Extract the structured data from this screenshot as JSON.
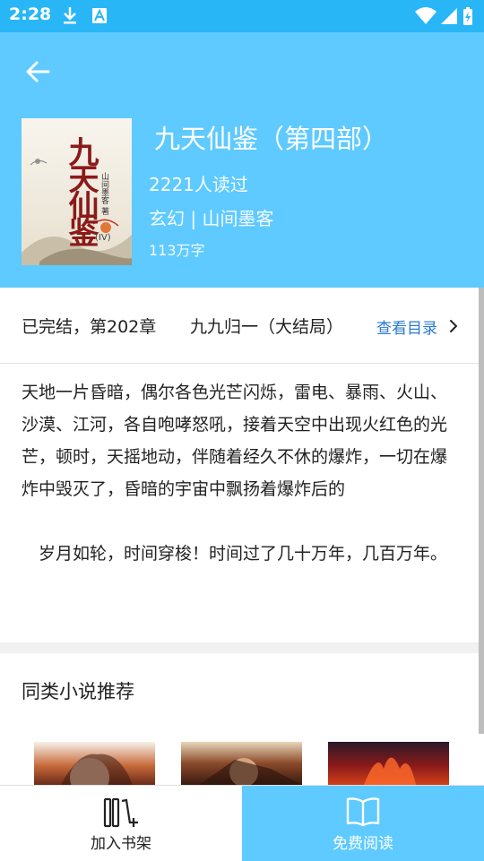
{
  "status_bar": {
    "time": "2:28"
  },
  "book": {
    "cover_title": "九天仙鉴",
    "cover_subtitle": "山间墨客 著",
    "cover_volume": "(IV)",
    "title": "九天仙鉴（第四部）",
    "readers": "2221人读过",
    "genre_author": "玄幻 | 山间墨客",
    "word_count": "113万字"
  },
  "chapter": {
    "status": "已完结，第202章",
    "latest_title": "九九归一（大结局）",
    "toc_label": "查看目录"
  },
  "synopsis": [
    "天地一片昏暗，偶尔各色光芒闪烁，雷电、暴雨、火山、沙漠、江河，各自咆哮怒吼，接着天空中出现火红色的光芒，顿时，天摇地动，伴随着经久不休的爆炸，一切在爆炸中毁灭了，昏暗的宇宙中飘扬着爆炸后的",
    "　岁月如轮，时间穿梭！时间过了几十万年，几百万年。"
  ],
  "recommendations": {
    "title": "同类小说推荐"
  },
  "bottom_bar": {
    "add_shelf_label": "加入书架",
    "free_read_label": "免费阅读"
  },
  "colors": {
    "header": "#5ecaff",
    "status_bar": "#29b6f6",
    "link": "#2979d2",
    "read_button": "#5ecaff"
  },
  "icons": [
    "download-icon",
    "font-icon",
    "wifi-icon",
    "signal-icon",
    "battery-icon",
    "back-arrow-icon",
    "chevron-right-icon",
    "bookshelf-add-icon",
    "open-book-icon"
  ]
}
